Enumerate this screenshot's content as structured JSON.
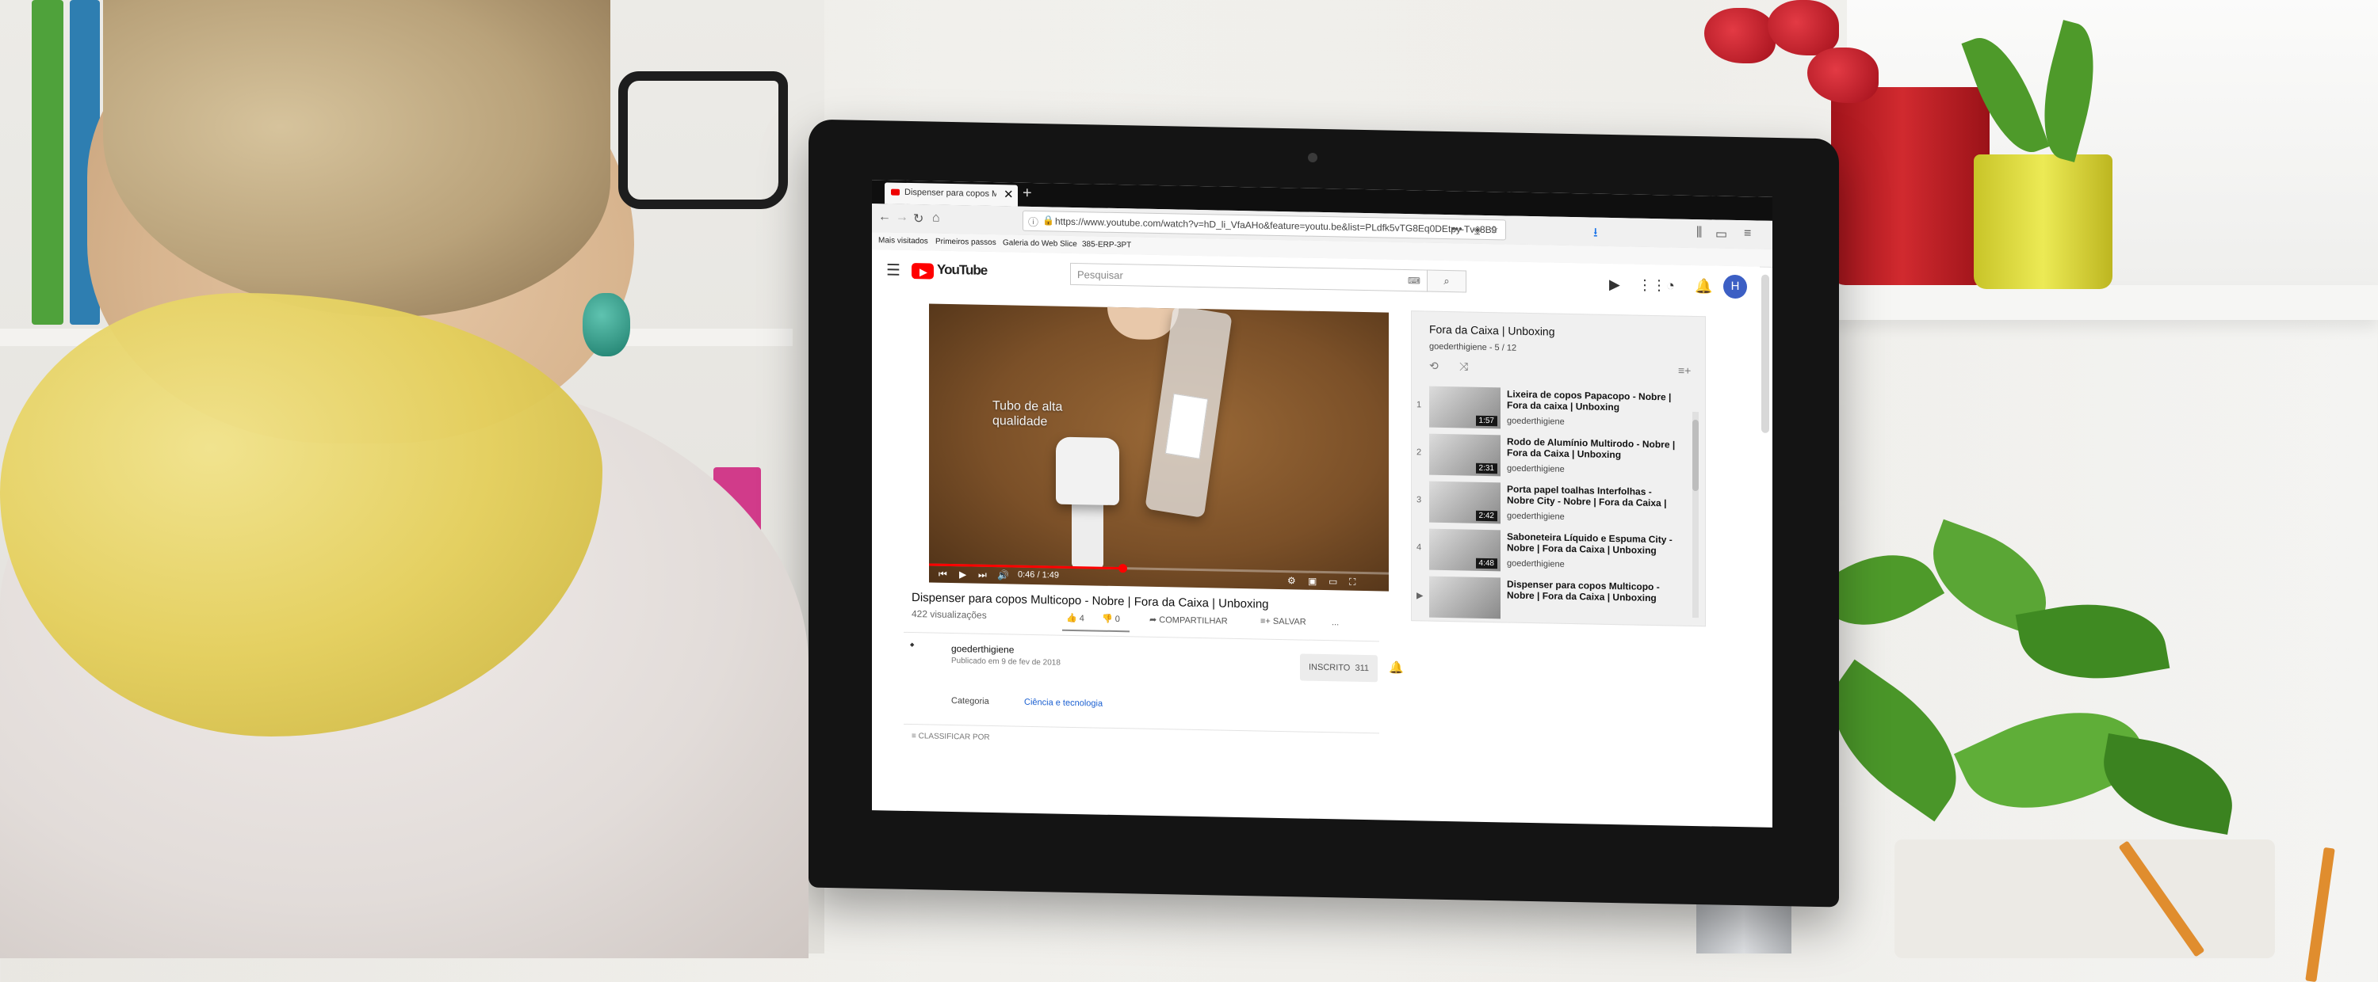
{
  "browser": {
    "tab_title": "Dispenser para copos Multicopo - N...",
    "url": "https://www.youtube.com/watch?v=hD_li_VfaAHo&feature=youtu.be&list=PLdfk5vTG8Eq0DEtpy-Tv_8B9",
    "bookmarks": [
      "Mais visitados",
      "Primeiros passos",
      "Galeria do Web Slice",
      "385-ERP-3PT"
    ]
  },
  "youtube": {
    "logo_text": "YouTube",
    "search_placeholder": "Pesquisar",
    "avatar_letter": "H"
  },
  "video": {
    "overlay_caption_line1": "Tubo de alta",
    "overlay_caption_line2": "qualidade",
    "time": "0:46 / 1:49",
    "progress": 0.42,
    "title": "Dispenser para copos Multicopo - Nobre | Fora da Caixa | Unboxing",
    "views": "422 visualizações",
    "likes": "4",
    "dislikes": "0",
    "share_label": "COMPARTILHAR",
    "save_label": "SALVAR",
    "more_label": "..."
  },
  "channel": {
    "name": "goederthigiene",
    "published": "Publicado em 9 de fev de 2018",
    "subscribe_label": "INSCRITO",
    "subscriber_count": "311",
    "category_label": "Categoria",
    "category_value": "Ciência e tecnologia",
    "sort_label": "CLASSIFICAR POR"
  },
  "playlist": {
    "title": "Fora da Caixa | Unboxing",
    "subtitle": "goederthigiene - 5 / 12",
    "items": [
      {
        "num": "1",
        "title": "Lixeira de copos Papacopo - Nobre | Fora da caixa | Unboxing",
        "channel": "goederthigiene",
        "duration": "1:57"
      },
      {
        "num": "2",
        "title": "Rodo de Alumínio Multirodo - Nobre | Fora da Caixa | Unboxing",
        "channel": "goederthigiene",
        "duration": "2:31"
      },
      {
        "num": "3",
        "title": "Porta papel toalhas Interfolhas - Nobre City - Nobre | Fora da Caixa |",
        "channel": "goederthigiene",
        "duration": "2:42"
      },
      {
        "num": "4",
        "title": "Saboneteira Líquido e Espuma City - Nobre | Fora da Caixa | Unboxing",
        "channel": "goederthigiene",
        "duration": "4:48"
      },
      {
        "num": "",
        "title": "Dispenser para copos Multicopo - Nobre | Fora da Caixa | Unboxing",
        "channel": "",
        "duration": ""
      }
    ]
  },
  "colors": {
    "youtube_red": "#ff0000",
    "link_blue": "#1a5fd1",
    "avatar_blue": "#3c5fc4"
  }
}
